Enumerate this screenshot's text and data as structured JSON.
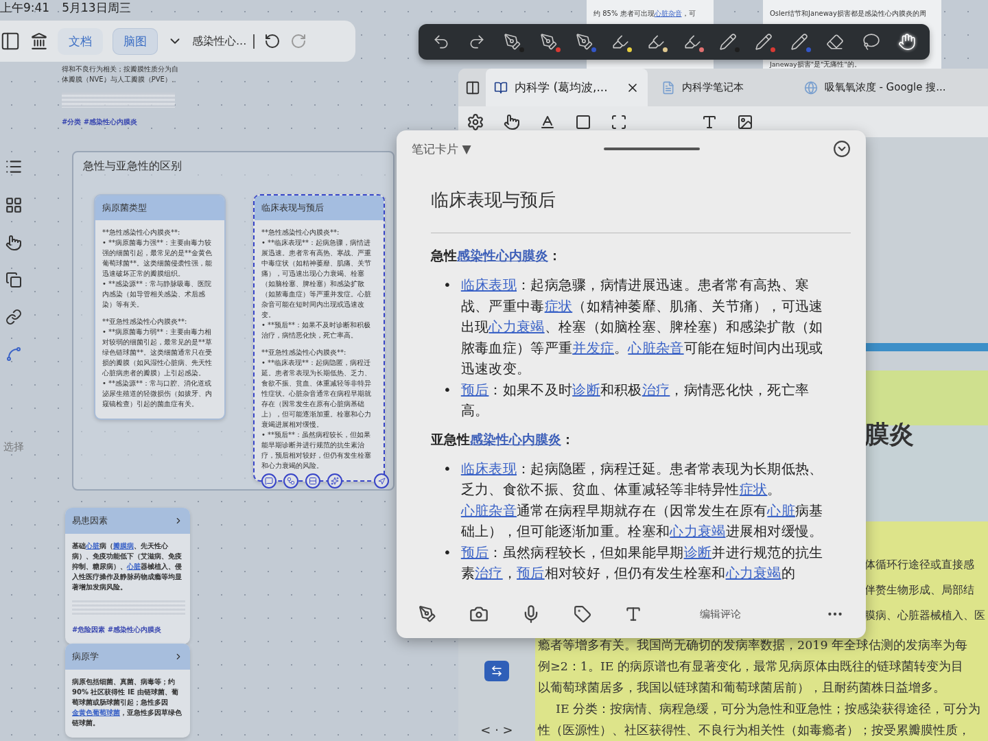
{
  "status_bar": {
    "time": "上午9:41",
    "date": "5月13日周三"
  },
  "mindmap_toolbar": {
    "tabs": [
      {
        "label": "文档",
        "selected": false
      },
      {
        "label": "脑图",
        "selected": true
      }
    ],
    "title": "感染性心..."
  },
  "sidebar": {
    "label": "选择"
  },
  "top_node": {
    "text": "得和不良行为相关；按瓣膜性质分为自体瓣膜（NVE）与人工瓣膜（PVE）。",
    "tags": "#分类 #感染性心内膜炎"
  },
  "group": {
    "title": "急性与亚急性的区别",
    "cards": [
      {
        "title": "病原菌类型",
        "selected": false,
        "blocks": [
          [
            "**急性感染性心内膜炎**:",
            "•  **病原菌毒力强**：主要由毒力较强的细菌引起，最常见的是**金黄色葡萄球菌**。这类细菌侵袭性强，能迅速破坏正常的瓣膜组织。",
            "•  **感染源**：常与静脉吸毒、医院内感染（如导管相关感染、术后感染）等有关。"
          ],
          [
            "**亚急性感染性心内膜炎**:",
            "•  **病原菌毒力弱**：主要由毒力相对较弱的细菌引起，最常见的是**草绿色链球菌**。这类细菌通常只在受损的瓣膜（如风湿性心脏病、先天性心脏病患者的瓣膜）上引起感染。",
            "•  **感染源**：常与口腔、消化道或泌尿生殖道的轻微损伤（如拔牙、内窥镜检查）引起的菌血症有关。"
          ]
        ]
      },
      {
        "title": "临床表现与预后",
        "selected": true,
        "blocks": [
          [
            "**急性感染性心内膜炎**:",
            "•  **临床表现**：起病急骤，病情进展迅速。患者常有高热、寒战、严重中毒症状（如精神萎靡、肌痛、关节痛），可迅速出现心力衰竭、栓塞（如脑栓塞、脾栓塞）和感染扩散（如脓毒血症）等严重并发症。心脏杂音可能在短时间内出现或迅速改变。",
            "•  **预后**：如果不及时诊断和积极治疗，病情恶化快，死亡率高。"
          ],
          [
            "**亚急性感染性心内膜炎**:",
            "•  **临床表现**：起病隐匿，病程迁延。患者常表现为长期低热、乏力、食欲不振、贫血、体重减轻等非特异性症状。心脏杂音通常在病程早期就存在（因常发生在原有心脏病基础上），但可能逐渐加重。栓塞和心力衰竭进展相对缓慢。",
            "•  **预后**：虽然病程较长，但如果能早期诊断并进行规范的抗生素治疗，预后相对较好，但仍有发生栓塞和心力衰竭的风险。"
          ]
        ]
      }
    ]
  },
  "side_cards": [
    {
      "title": "易患因素",
      "segments": [
        {
          "t": "基础",
          "kind": "text"
        },
        {
          "t": "心脏",
          "kind": "link"
        },
        {
          "t": "病（",
          "kind": "text"
        },
        {
          "t": "瓣膜病",
          "kind": "link"
        },
        {
          "t": "、先天性心病）、免疫功能低下（艾滋病、免疫抑制、糖尿病）、",
          "kind": "text"
        },
        {
          "t": "心脏",
          "kind": "link"
        },
        {
          "t": "器械植入、侵入性医疗操作及静脉药物成瘾等均显著增加发病风险。",
          "kind": "text"
        }
      ],
      "tags": "#危险因素 #感染性心内膜炎"
    },
    {
      "title": "病原学",
      "segments": [
        {
          "t": "病原包括细菌、真菌、病毒等；约 90% 社区获得性 IE 由链球菌、葡萄球菌或肠球菌引起；急性多因",
          "kind": "text"
        },
        {
          "t": "金黄色葡萄球菌",
          "kind": "link"
        },
        {
          "t": "，亚急性多因草绿色链球菌。",
          "kind": "text"
        }
      ]
    }
  ],
  "pen_toolbar": {
    "tools": [
      {
        "kind": "undo",
        "selected": false
      },
      {
        "kind": "redo",
        "selected": false
      },
      {
        "kind": "pen",
        "color": "#1e1e1e",
        "selected": false
      },
      {
        "kind": "pen",
        "color": "#d83a34",
        "selected": false
      },
      {
        "kind": "pen",
        "color": "#3356c8",
        "selected": false
      },
      {
        "kind": "highlighter",
        "color": "#e8d040",
        "selected": false
      },
      {
        "kind": "highlighter",
        "color": "#e0c890",
        "selected": false
      },
      {
        "kind": "highlighter",
        "color": "#e07070",
        "selected": false
      },
      {
        "kind": "pencil",
        "color": "#1e1e1e",
        "selected": false
      },
      {
        "kind": "pencil",
        "color": "#d83a34",
        "selected": false
      },
      {
        "kind": "pencil",
        "color": "#3356c8",
        "selected": false
      },
      {
        "kind": "eraser",
        "selected": false
      },
      {
        "kind": "lasso",
        "selected": false
      },
      {
        "kind": "hand",
        "selected": true
      }
    ]
  },
  "background_pages": [
    {
      "segments": [
        {
          "t": "约 85% 患者可出现",
          "kind": "text"
        },
        {
          "t": "心脏杂音",
          "kind": "link"
        },
        {
          "t": "，可",
          "kind": "text"
        }
      ]
    },
    {
      "segments": [
        {
          "t": "Osler结节和Janeway损害都是感染性心内膜炎的周",
          "kind": "text"
        }
      ],
      "tail": "Janeway损害\"是\"无痛性\"的。"
    }
  ],
  "reader": {
    "tabs": [
      {
        "label": "内科学 (葛均波,...",
        "selected": true,
        "kind": "book"
      },
      {
        "label": "内科学笔记本",
        "selected": false,
        "kind": "notebook"
      },
      {
        "label": "吸氧氧浓度 - Google 搜...",
        "selected": false,
        "kind": "web"
      }
    ],
    "page": {
      "heading": "膜炎",
      "side_lines": [
        "体循环行途径或直接感",
        "伴赘生物形成、局部结",
        "膜病、心脏器械植入、医"
      ],
      "lines": [
        "瘾者等增多有关。我国尚无确切的发病率数据，2019 年全球估测的发病率为每",
        "例≥2：1。IE 的病原谱也有显著变化，最常见病原体由既往的链球菌转变为目",
        "以葡萄球菌居多，我国以链球菌和葡萄球菌居前），且耐药菌株日益增多。",
        "IE 分类：按病情、病程急缓，可分为急性和亚急性；按感染获得途径，可分为",
        "性（医源性）、社区获得性、不良行为相关性（如毒瘾者）；按受累瓣膜性质，"
      ]
    },
    "nav": "< · >"
  },
  "note_card": {
    "header": "笔记卡片 ▼",
    "title": "临床表现与预后",
    "comment": "编辑评论",
    "bullet": "•",
    "sections": [
      {
        "lead": "急性",
        "term": "感染性心内膜炎",
        "end": "：",
        "items": [
          [
            {
              "t": "临床表现",
              "kind": "link"
            },
            {
              "t": "：起病急骤，病情进展迅速。患者常有高热、寒战、严重中毒",
              "kind": "text"
            },
            {
              "t": "症状",
              "kind": "link"
            },
            {
              "t": "（如精神萎靡、肌痛、关节痛），可迅速出现",
              "kind": "text"
            },
            {
              "t": "心力衰竭",
              "kind": "link"
            },
            {
              "t": "、栓塞（如脑栓塞、脾栓塞）和感染扩散（如脓毒血症）等严重",
              "kind": "text"
            },
            {
              "t": "并发症",
              "kind": "link"
            },
            {
              "t": "。",
              "kind": "text"
            },
            {
              "t": "心脏杂音",
              "kind": "link"
            },
            {
              "t": "可能在短时间内出现或迅速改变。",
              "kind": "text"
            }
          ],
          [
            {
              "t": "预后",
              "kind": "link"
            },
            {
              "t": "：如果不及时",
              "kind": "text"
            },
            {
              "t": "诊断",
              "kind": "link"
            },
            {
              "t": "和积极",
              "kind": "text"
            },
            {
              "t": "治疗",
              "kind": "link"
            },
            {
              "t": "，病情恶化快，死亡率高。",
              "kind": "text"
            }
          ]
        ]
      },
      {
        "lead": "亚急性",
        "term": "感染性心内膜炎",
        "end": "：",
        "items": [
          [
            {
              "t": "临床表现",
              "kind": "link"
            },
            {
              "t": "：起病隐匿，病程迁延。患者常表现为长期低热、乏力、食欲不振、贫血、体重减轻等非特异性",
              "kind": "text"
            },
            {
              "t": "症状",
              "kind": "link"
            },
            {
              "t": "。",
              "kind": "text"
            },
            {
              "t": "心脏杂音",
              "kind": "link"
            },
            {
              "t": "通常在病程早期就存在（因常发生在原有",
              "kind": "text"
            },
            {
              "t": "心脏",
              "kind": "link"
            },
            {
              "t": "病基础上），但可能逐渐加重。栓塞和",
              "kind": "text"
            },
            {
              "t": "心力衰竭",
              "kind": "link"
            },
            {
              "t": "进展相对缓慢。",
              "kind": "text"
            }
          ],
          [
            {
              "t": "预后",
              "kind": "link"
            },
            {
              "t": "：虽然病程较长，但如果能早期",
              "kind": "text"
            },
            {
              "t": "诊断",
              "kind": "link"
            },
            {
              "t": "并进行规范的抗生素",
              "kind": "text"
            },
            {
              "t": "治疗",
              "kind": "link"
            },
            {
              "t": "，",
              "kind": "text"
            },
            {
              "t": "预后",
              "kind": "link"
            },
            {
              "t": "相对较好，但仍有发生栓塞和",
              "kind": "text"
            },
            {
              "t": "心力衰竭",
              "kind": "link"
            },
            {
              "t": "的",
              "kind": "text"
            }
          ]
        ]
      }
    ]
  }
}
